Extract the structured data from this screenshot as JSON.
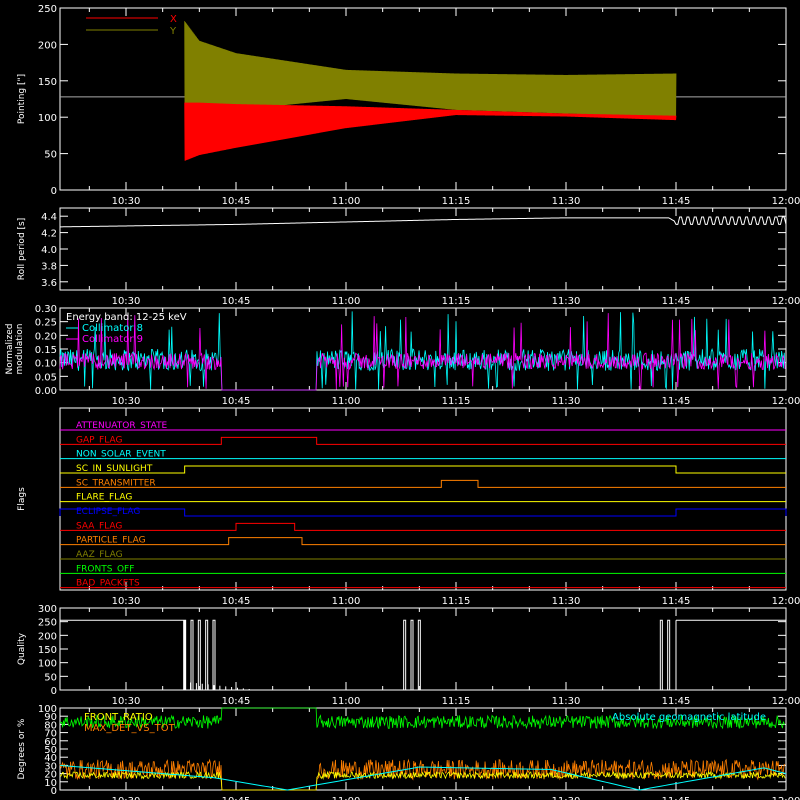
{
  "chart_data": {
    "type": "line",
    "time_axis": {
      "start": "10:21",
      "end": "12:00",
      "ticks": [
        "10:30",
        "10:45",
        "11:00",
        "11:15",
        "11:30",
        "11:45",
        "12:00"
      ]
    },
    "panels": [
      {
        "id": "pointing",
        "ylabel": "Pointing [\"]",
        "ylim": [
          0,
          250
        ],
        "yticks": [
          "0",
          "50",
          "100",
          "150",
          "200",
          "250"
        ],
        "reference_line": 128,
        "legend": [
          {
            "name": "X",
            "color": "#ff0000"
          },
          {
            "name": "Y",
            "color": "#808000"
          }
        ],
        "data_start": "10:38",
        "data_end": "11:45",
        "series": [
          {
            "name": "Y",
            "color": "#808000",
            "x": [
              "10:38",
              "10:40",
              "10:45",
              "11:00",
              "11:15",
              "11:30",
              "11:45"
            ],
            "upper": [
              232,
              205,
              188,
              165,
              160,
              158,
              160
            ],
            "lower": [
              90,
              98,
              110,
              125,
              110,
              105,
              100
            ]
          },
          {
            "name": "X",
            "color": "#ff0000",
            "x": [
              "10:38",
              "10:40",
              "10:45",
              "11:00",
              "11:15",
              "11:30",
              "11:45"
            ],
            "upper": [
              120,
              120,
              118,
              115,
              110,
              105,
              102
            ],
            "lower": [
              40,
              48,
              58,
              85,
              103,
              101,
              96
            ]
          }
        ]
      },
      {
        "id": "roll",
        "ylabel": "Roll period [s]",
        "ylim": [
          3.5,
          4.5
        ],
        "yticks": [
          "3.6",
          "3.8",
          "4.0",
          "4.2",
          "4.4"
        ],
        "series": [
          {
            "name": "roll",
            "color": "#ffffff",
            "x": [
              "10:21",
              "10:45",
              "11:00",
              "11:15",
              "11:30",
              "11:44",
              "11:45",
              "12:00"
            ],
            "y": [
              4.27,
              4.3,
              4.33,
              4.36,
              4.38,
              4.38,
              4.33,
              4.33
            ]
          }
        ]
      },
      {
        "id": "modulation",
        "ylabel": "Normalized modulation",
        "ylim": [
          0,
          0.3
        ],
        "yticks": [
          "0.00",
          "0.05",
          "0.10",
          "0.15",
          "0.20",
          "0.25",
          "0.30"
        ],
        "legend": [
          {
            "name": "Energy band: 12-25 keV",
            "color": "#ffffff"
          },
          {
            "name": "Collimator 8",
            "color": "#00ffff"
          },
          {
            "name": "Collimator 9",
            "color": "#ff00ff"
          }
        ],
        "gap": [
          "10:43",
          "10:56"
        ],
        "series": [
          {
            "name": "Collimator 8",
            "color": "#00ffff",
            "mean": 0.11,
            "spread": 0.04
          },
          {
            "name": "Collimator 9",
            "color": "#ff00ff",
            "mean": 0.105,
            "spread": 0.03
          }
        ]
      },
      {
        "id": "flags",
        "ylabel": "Flags",
        "flags": [
          {
            "name": "ATTENUATOR_STATE",
            "color": "#ff00ff",
            "on": []
          },
          {
            "name": "GAP_FLAG",
            "color": "#ff0000",
            "on": [
              [
                "10:43",
                "10:56"
              ]
            ]
          },
          {
            "name": "NON_SOLAR_EVENT",
            "color": "#00ffff",
            "on": []
          },
          {
            "name": "SC_IN_SUNLIGHT",
            "color": "#ffff00",
            "on": [
              [
                "10:38",
                "11:45"
              ]
            ]
          },
          {
            "name": "SC_TRANSMITTER",
            "color": "#ff8000",
            "on": [
              [
                "11:13",
                "11:18"
              ]
            ]
          },
          {
            "name": "FLARE_FLAG",
            "color": "#ffff00",
            "on": []
          },
          {
            "name": "ECLIPSE_FLAG",
            "color": "#0000ff",
            "on": [
              [
                "10:21",
                "10:38"
              ],
              [
                "11:45",
                "12:00"
              ]
            ]
          },
          {
            "name": "SAA_FLAG",
            "color": "#ff0000",
            "on": [
              [
                "10:45",
                "10:53"
              ]
            ]
          },
          {
            "name": "PARTICLE_FLAG",
            "color": "#ff8000",
            "on": [
              [
                "10:44",
                "10:54"
              ]
            ]
          },
          {
            "name": "AAZ_FLAG",
            "color": "#808000",
            "on": []
          },
          {
            "name": "FRONTS_OFF",
            "color": "#00ff00",
            "on": []
          },
          {
            "name": "BAD_PACKETS",
            "color": "#ff0000",
            "on": []
          }
        ]
      },
      {
        "id": "quality",
        "ylabel": "Quality",
        "ylim": [
          0,
          300
        ],
        "yticks": [
          "0",
          "50",
          "100",
          "150",
          "200",
          "250",
          "300"
        ],
        "series": [
          {
            "name": "quality",
            "color": "#ffffff",
            "high_periods": [
              [
                "10:21",
                "10:38"
              ],
              [
                "11:45",
                "12:00"
              ]
            ],
            "spikes": [
              "10:38",
              "10:39",
              "10:40",
              "10:41",
              "10:42",
              "11:08",
              "11:09",
              "11:10",
              "11:43",
              "11:44"
            ],
            "high": 255,
            "low": 0
          }
        ]
      },
      {
        "id": "ratios",
        "ylabel": "Degrees or %",
        "ylim": [
          0,
          100
        ],
        "yticks": [
          "0",
          "10",
          "20",
          "30",
          "40",
          "50",
          "60",
          "70",
          "80",
          "90",
          "100"
        ],
        "legend": [
          {
            "name": "FRONT_RATIO",
            "color": "#ffff00",
            "position": "top-left"
          },
          {
            "name": "MAX_DET_VS_TOT",
            "color": "#ff8000",
            "position": "top-left"
          },
          {
            "name": "Absolute geomagnetic latitude",
            "color": "#00ffff",
            "position": "top-right"
          }
        ],
        "gap": [
          "10:43",
          "10:56"
        ],
        "series": [
          {
            "name": "green",
            "color": "#00ff00",
            "mean": 83,
            "spread": 8
          },
          {
            "name": "MAX_DET_VS_TOT",
            "color": "#ff8000",
            "mean": 25,
            "spread": 12
          },
          {
            "name": "FRONT_RATIO",
            "color": "#ffff00",
            "mean": 18,
            "spread": 4
          },
          {
            "name": "Absolute geomagnetic latitude",
            "color": "#00ffff",
            "x": [
              "10:21",
              "10:42",
              "10:52",
              "11:10",
              "11:28",
              "11:40",
              "11:57",
              "12:00"
            ],
            "y": [
              30,
              15,
              0,
              28,
              25,
              0,
              27,
              20
            ]
          }
        ]
      }
    ]
  }
}
